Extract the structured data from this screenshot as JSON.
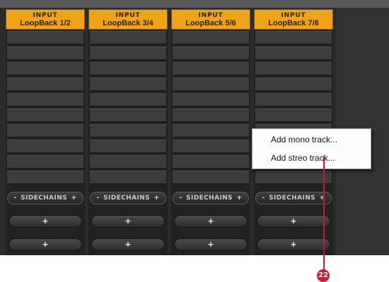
{
  "channels": [
    {
      "type": "INPUT",
      "name": "LoopBack 1/2"
    },
    {
      "type": "INPUT",
      "name": "LoopBack 3/4"
    },
    {
      "type": "INPUT",
      "name": "LoopBack 5/6"
    },
    {
      "type": "INPUT",
      "name": "LoopBack 7/8"
    }
  ],
  "sidechains": {
    "minus": "-",
    "label": "SIDECHAINS",
    "plus": "+"
  },
  "add_button_label": "+",
  "context_menu": {
    "items": [
      {
        "label": "Add mono track..."
      },
      {
        "label": "Add streo track..."
      }
    ]
  },
  "callout": {
    "number": "22",
    "color": "#d6162f"
  },
  "colors": {
    "header": "#efa417",
    "background": "#2b2b2b"
  }
}
